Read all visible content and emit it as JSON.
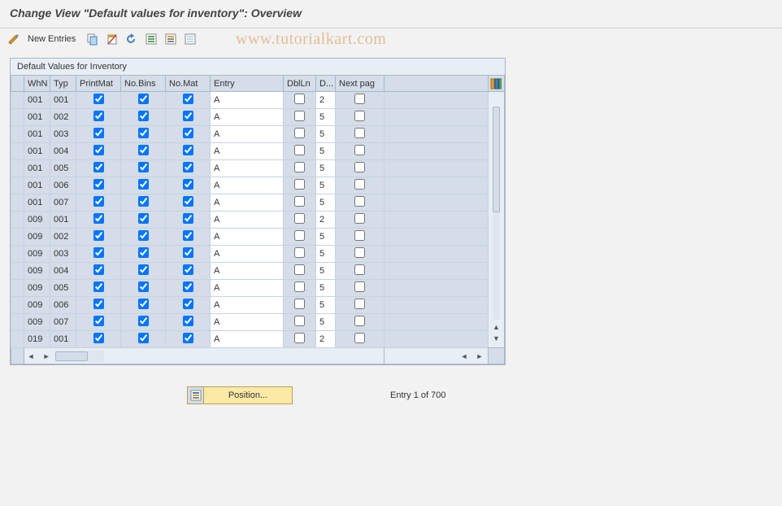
{
  "title": "Change View \"Default values for inventory\": Overview",
  "toolbar": {
    "new_entries": "New Entries"
  },
  "watermark": "www.tutorialkart.com",
  "panel_title": "Default Values for Inventory",
  "columns": {
    "sel": "",
    "whn": "WhN",
    "typ": "Typ",
    "printmat": "PrintMat",
    "nobins": "No.Bins",
    "nomat": "No.Mat",
    "entry": "Entry",
    "dblln": "DblLn",
    "d": "D...",
    "nextpag": "Next pag"
  },
  "rows": [
    {
      "whn": "001",
      "typ": "001",
      "pm": true,
      "nb": true,
      "nm": true,
      "entry": "A",
      "dbl": false,
      "d": "2",
      "np": false
    },
    {
      "whn": "001",
      "typ": "002",
      "pm": true,
      "nb": true,
      "nm": true,
      "entry": "A",
      "dbl": false,
      "d": "5",
      "np": false
    },
    {
      "whn": "001",
      "typ": "003",
      "pm": true,
      "nb": true,
      "nm": true,
      "entry": "A",
      "dbl": false,
      "d": "5",
      "np": false
    },
    {
      "whn": "001",
      "typ": "004",
      "pm": true,
      "nb": true,
      "nm": true,
      "entry": "A",
      "dbl": false,
      "d": "5",
      "np": false
    },
    {
      "whn": "001",
      "typ": "005",
      "pm": true,
      "nb": true,
      "nm": true,
      "entry": "A",
      "dbl": false,
      "d": "5",
      "np": false
    },
    {
      "whn": "001",
      "typ": "006",
      "pm": true,
      "nb": true,
      "nm": true,
      "entry": "A",
      "dbl": false,
      "d": "5",
      "np": false
    },
    {
      "whn": "001",
      "typ": "007",
      "pm": true,
      "nb": true,
      "nm": true,
      "entry": "A",
      "dbl": false,
      "d": "5",
      "np": false
    },
    {
      "whn": "009",
      "typ": "001",
      "pm": true,
      "nb": true,
      "nm": true,
      "entry": "A",
      "dbl": false,
      "d": "2",
      "np": false
    },
    {
      "whn": "009",
      "typ": "002",
      "pm": true,
      "nb": true,
      "nm": true,
      "entry": "A",
      "dbl": false,
      "d": "5",
      "np": false
    },
    {
      "whn": "009",
      "typ": "003",
      "pm": true,
      "nb": true,
      "nm": true,
      "entry": "A",
      "dbl": false,
      "d": "5",
      "np": false
    },
    {
      "whn": "009",
      "typ": "004",
      "pm": true,
      "nb": true,
      "nm": true,
      "entry": "A",
      "dbl": false,
      "d": "5",
      "np": false
    },
    {
      "whn": "009",
      "typ": "005",
      "pm": true,
      "nb": true,
      "nm": true,
      "entry": "A",
      "dbl": false,
      "d": "5",
      "np": false
    },
    {
      "whn": "009",
      "typ": "006",
      "pm": true,
      "nb": true,
      "nm": true,
      "entry": "A",
      "dbl": false,
      "d": "5",
      "np": false
    },
    {
      "whn": "009",
      "typ": "007",
      "pm": true,
      "nb": true,
      "nm": true,
      "entry": "A",
      "dbl": false,
      "d": "5",
      "np": false
    },
    {
      "whn": "019",
      "typ": "001",
      "pm": true,
      "nb": true,
      "nm": true,
      "entry": "A",
      "dbl": false,
      "d": "2",
      "np": false
    }
  ],
  "position_label": "Position...",
  "entry_status": "Entry 1 of 700"
}
